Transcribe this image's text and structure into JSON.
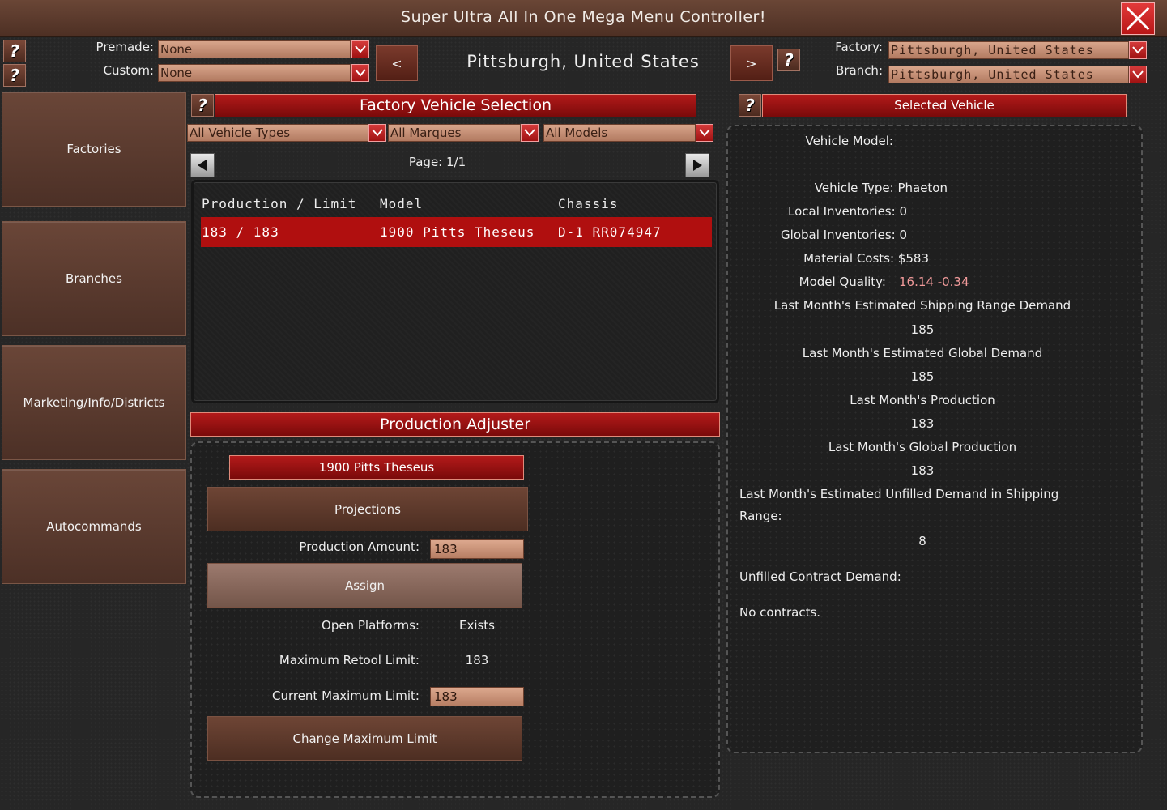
{
  "window": {
    "title": "Super  Ultra  All  In  One  Mega  Menu  Controller!"
  },
  "top": {
    "premade_label": "Premade:",
    "premade_value": "None",
    "custom_label": "Custom:",
    "custom_value": "None",
    "prev_label": "<",
    "next_label": ">",
    "location": "Pittsburgh,  United  States",
    "factory_label": "Factory:",
    "factory_value": "Pittsburgh, United States",
    "branch_label": "Branch:",
    "branch_value": "Pittsburgh, United States",
    "help_glyph": "?"
  },
  "sidebar": {
    "items": [
      {
        "label": "Factories"
      },
      {
        "label": "Branches"
      },
      {
        "label": "Marketing/Info/Districts"
      },
      {
        "label": "Autocommands"
      }
    ]
  },
  "selection": {
    "title": "Factory  Vehicle  Selection",
    "filters": {
      "types": "All  Vehicle  Types",
      "marques": "All  Marques",
      "models": "All  Models"
    },
    "page": "Page:  1/1",
    "columns": [
      "Production / Limit",
      "Model",
      "Chassis"
    ],
    "rows": [
      {
        "production": "183 / 183",
        "model": "1900 Pitts Theseus",
        "chassis": "D-1 RR074947"
      }
    ]
  },
  "adjuster": {
    "title": "Production  Adjuster",
    "model_name": "1900  Pitts  Theseus",
    "projections_label": "Projections",
    "production_amount_label": "Production  Amount:",
    "production_amount_value": "183",
    "assign_label": "Assign",
    "open_platforms_label": "Open  Platforms:",
    "open_platforms_value": "Exists",
    "max_retool_label": "Maximum  Retool  Limit:",
    "max_retool_value": "183",
    "current_max_label": "Current  Maximum  Limit:",
    "current_max_value": "183",
    "change_max_label": "Change  Maximum  Limit"
  },
  "selected": {
    "title": "Selected  Vehicle",
    "vehicle_model_label": "Vehicle  Model:",
    "vehicle_type": "Vehicle  Type:  Phaeton",
    "local_inv": "Local  Inventories:  0",
    "global_inv": "Global  Inventories:  0",
    "material_costs": "Material  Costs:  $583",
    "model_quality_label": "Model  Quality:",
    "model_quality_value": "16.14  -0.34",
    "shipping_demand_label": "Last  Month's  Estimated  Shipping  Range  Demand",
    "shipping_demand_value": "185",
    "global_demand_label": "Last  Month's  Estimated  Global  Demand",
    "global_demand_value": "185",
    "production_label": "Last  Month's  Production",
    "production_value": "183",
    "global_production_label": "Last  Month's  Global  Production",
    "global_production_value": "183",
    "unfilled_label_1": "Last  Month's  Estimated  Unfilled  Demand  in  Shipping",
    "unfilled_label_2": "Range:",
    "unfilled_value": "8",
    "contract_label": "Unfilled  Contract  Demand:",
    "contracts": "No  contracts."
  },
  "colors": {
    "accent_red": "#b00f0f",
    "quality": "#f19a9a",
    "close": "#d42a2a"
  }
}
